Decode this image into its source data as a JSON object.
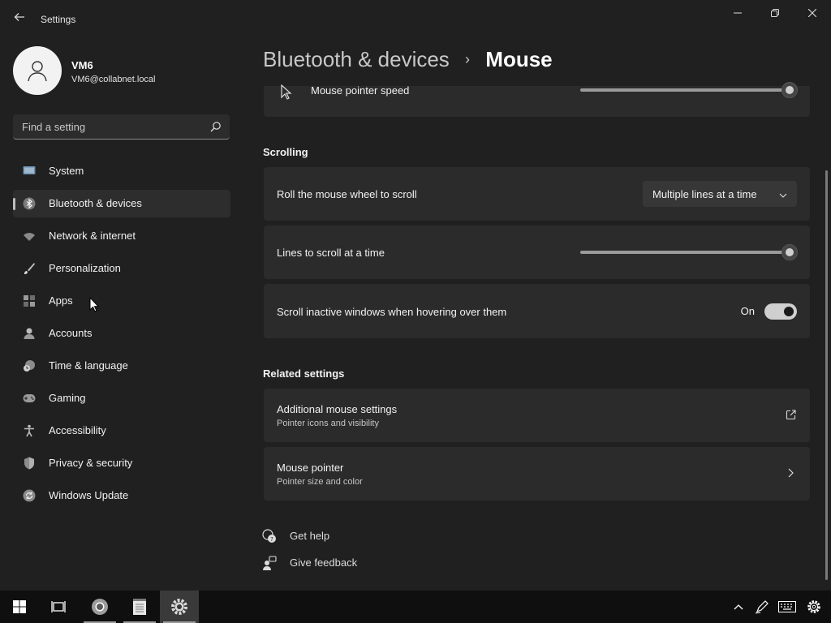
{
  "app": {
    "title": "Settings",
    "window_controls": {
      "minimize": "minimize",
      "maximize": "restore",
      "close": "close"
    }
  },
  "user": {
    "name": "VM6",
    "email": "VM6@collabnet.local"
  },
  "search": {
    "placeholder": "Find a setting"
  },
  "sidebar": {
    "items": [
      {
        "label": "System",
        "icon": "monitor-icon",
        "active": false
      },
      {
        "label": "Bluetooth & devices",
        "icon": "bluetooth-icon",
        "active": true
      },
      {
        "label": "Network & internet",
        "icon": "wifi-icon",
        "active": false
      },
      {
        "label": "Personalization",
        "icon": "brush-icon",
        "active": false
      },
      {
        "label": "Apps",
        "icon": "apps-icon",
        "active": false
      },
      {
        "label": "Accounts",
        "icon": "person-icon",
        "active": false
      },
      {
        "label": "Time & language",
        "icon": "clock-globe-icon",
        "active": false
      },
      {
        "label": "Gaming",
        "icon": "gamepad-icon",
        "active": false
      },
      {
        "label": "Accessibility",
        "icon": "accessibility-icon",
        "active": false
      },
      {
        "label": "Privacy & security",
        "icon": "shield-icon",
        "active": false
      },
      {
        "label": "Windows Update",
        "icon": "update-icon",
        "active": false
      }
    ]
  },
  "breadcrumb": {
    "parent": "Bluetooth & devices",
    "separator": "›",
    "current": "Mouse"
  },
  "pointer_speed": {
    "label": "Mouse pointer speed",
    "value_fraction": 1.0
  },
  "scrolling": {
    "title": "Scrolling",
    "roll_wheel": {
      "label": "Roll the mouse wheel to scroll",
      "value": "Multiple lines at a time"
    },
    "lines_to_scroll": {
      "label": "Lines to scroll at a time",
      "value_fraction": 1.0
    },
    "inactive_scroll": {
      "label": "Scroll inactive windows when hovering over them",
      "state": "On",
      "enabled": true
    }
  },
  "related": {
    "title": "Related settings",
    "items": [
      {
        "label": "Additional mouse settings",
        "sub": "Pointer icons and visibility",
        "icon": "external-link-icon"
      },
      {
        "label": "Mouse pointer",
        "sub": "Pointer size and color",
        "icon": "chevron-right-icon"
      }
    ]
  },
  "help": {
    "get_help": "Get help",
    "give_feedback": "Give feedback"
  },
  "taskbar": {
    "buttons": [
      "start-icon",
      "task-view-icon",
      "chrome-icon",
      "notepad-icon",
      "settings-icon"
    ],
    "tray": [
      "chevron-up-icon",
      "pen-icon",
      "keyboard-icon",
      "gear-icon"
    ]
  },
  "colors": {
    "background": "#202020",
    "card": "#2b2b2b",
    "taskbar": "#0f0f0f",
    "accent": "#cfcfcf"
  }
}
